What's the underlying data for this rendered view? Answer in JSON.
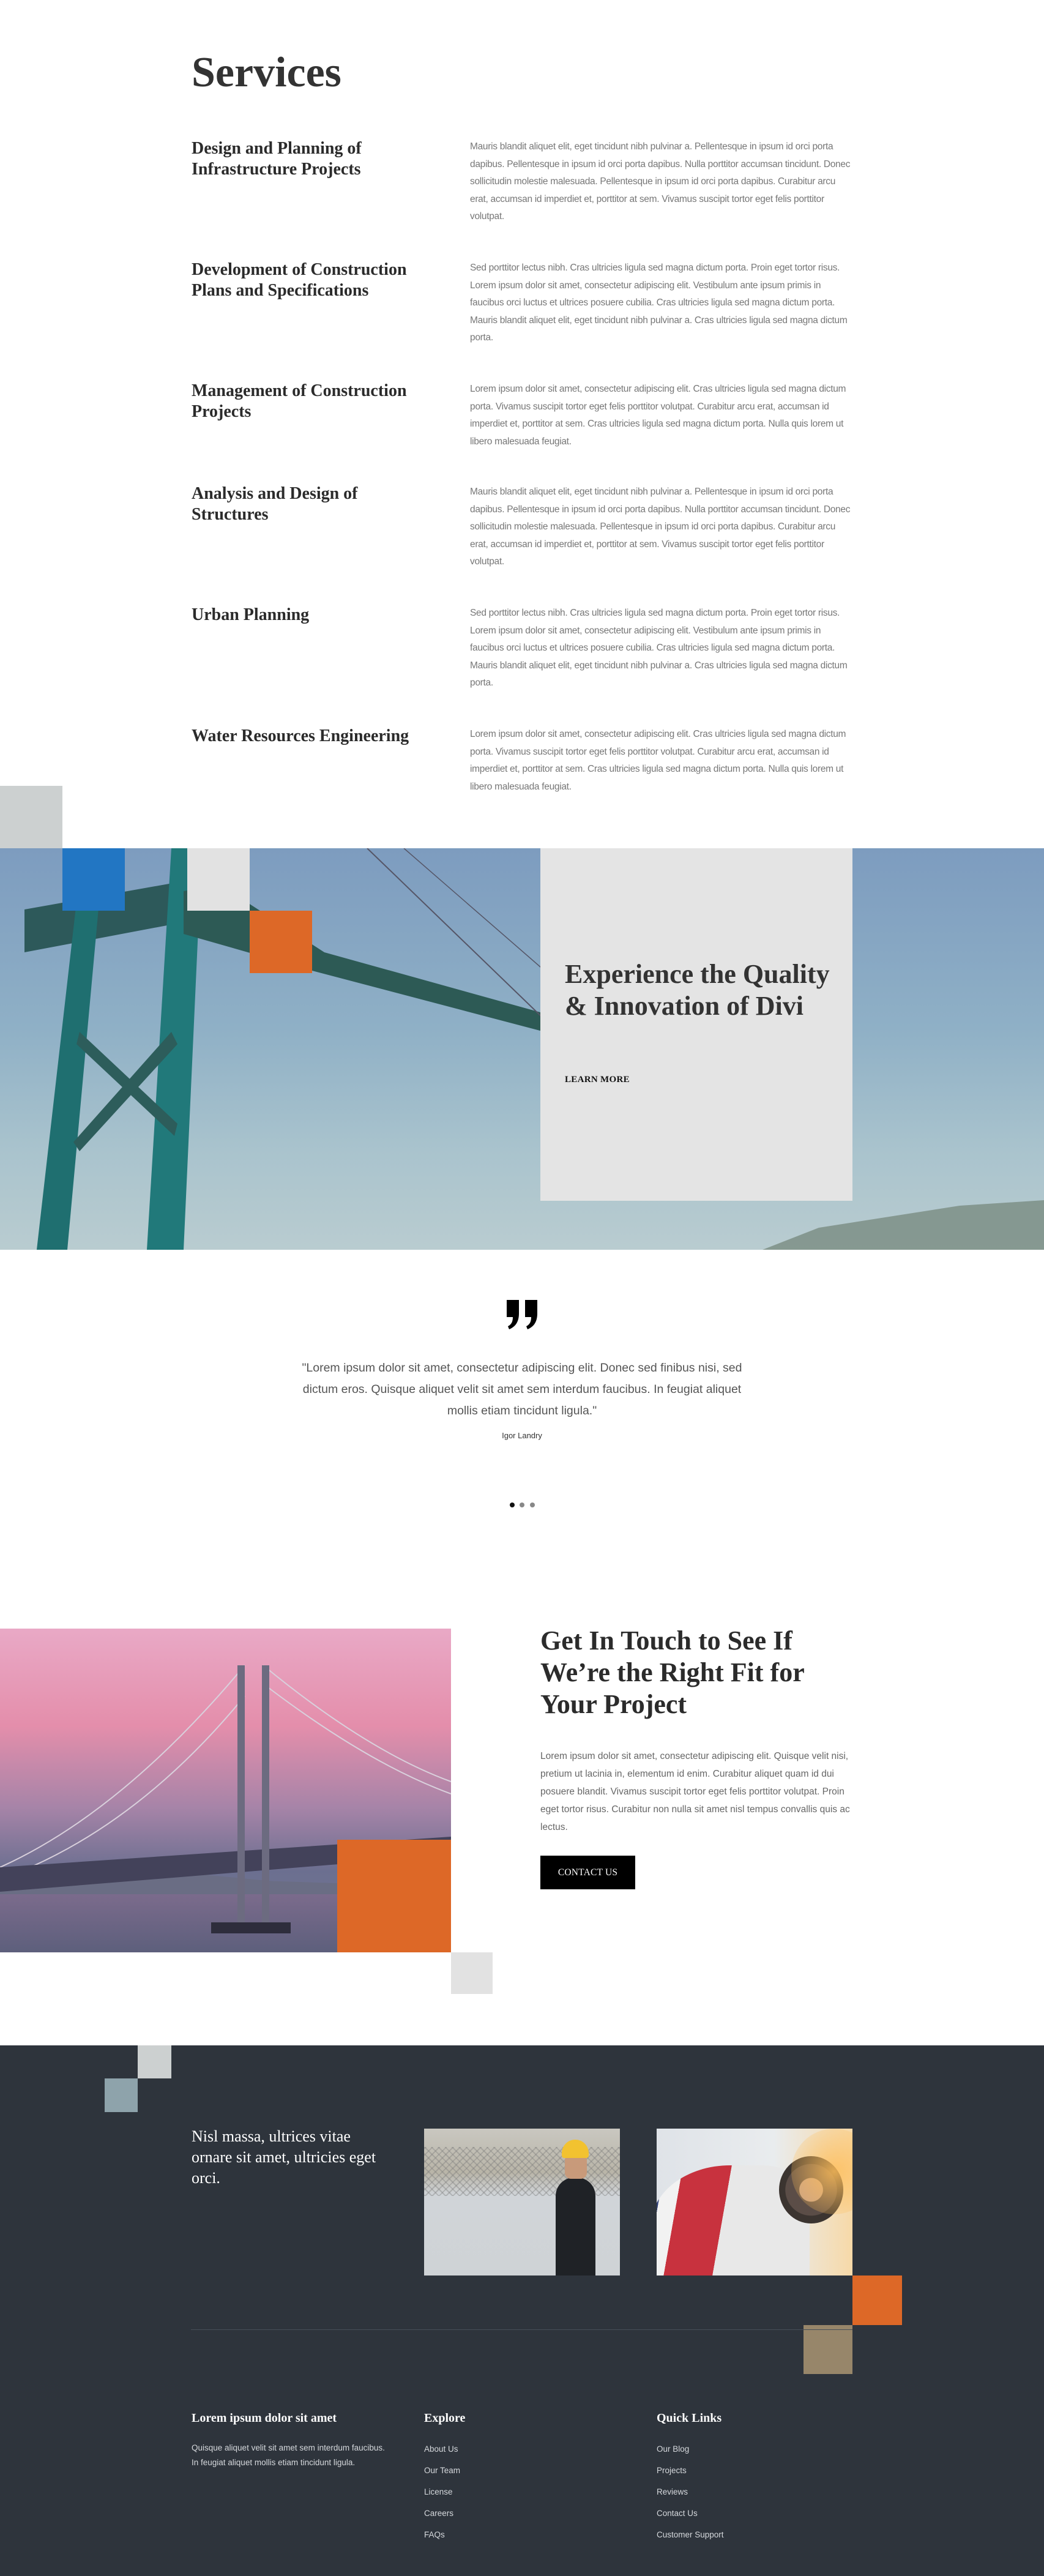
{
  "colors": {
    "accent_orange": "#dd6827",
    "accent_blue": "#2276c3",
    "light_gray": "#e2e2e2",
    "mid_gray": "#ccd0d0",
    "slate_blue_gray": "#8ea3ab",
    "khaki": "#97866a",
    "footer_bg": "#2e343c",
    "card_bg": "#e4e4e4"
  },
  "services": {
    "title": "Services",
    "items": [
      {
        "heading": "Design and Planning of Infrastructure Projects",
        "body": "Mauris blandit aliquet elit, eget tincidunt nibh pulvinar a. Pellentesque in ipsum id orci porta dapibus. Pellentesque in ipsum id orci porta dapibus. Nulla porttitor accumsan tincidunt. Donec sollicitudin molestie malesuada. Pellentesque in ipsum id orci porta dapibus. Curabitur arcu erat, accumsan id imperdiet et, porttitor at sem. Vivamus suscipit tortor eget felis porttitor volutpat."
      },
      {
        "heading": "Development of Construction Plans and Specifications",
        "body": "Sed porttitor lectus nibh. Cras ultricies ligula sed magna dictum porta. Proin eget tortor risus. Lorem ipsum dolor sit amet, consectetur adipiscing elit. Vestibulum ante ipsum primis in faucibus orci luctus et ultrices posuere cubilia. Cras ultricies ligula sed magna dictum porta. Mauris blandit aliquet elit, eget tincidunt nibh pulvinar a. Cras ultricies ligula sed magna dictum porta."
      },
      {
        "heading": "Management of Construction Projects",
        "body": "Lorem ipsum dolor sit amet, consectetur adipiscing elit. Cras ultricies ligula sed magna dictum porta. Vivamus suscipit tortor eget felis porttitor volutpat. Curabitur arcu erat, accumsan id imperdiet et, porttitor at sem. Cras ultricies ligula sed magna dictum porta. Nulla quis lorem ut libero malesuada feugiat."
      },
      {
        "heading": "Analysis and Design of Structures",
        "body": "Mauris blandit aliquet elit, eget tincidunt nibh pulvinar a. Pellentesque in ipsum id orci porta dapibus. Pellentesque in ipsum id orci porta dapibus. Nulla porttitor accumsan tincidunt. Donec sollicitudin molestie malesuada. Pellentesque in ipsum id orci porta dapibus. Curabitur arcu erat, accumsan id imperdiet et, porttitor at sem. Vivamus suscipit tortor eget felis porttitor volutpat."
      },
      {
        "heading": "Urban Planning",
        "body": "Sed porttitor lectus nibh. Cras ultricies ligula sed magna dictum porta. Proin eget tortor risus. Lorem ipsum dolor sit amet, consectetur adipiscing elit. Vestibulum ante ipsum primis in faucibus orci luctus et ultrices posuere cubilia. Cras ultricies ligula sed magna dictum porta. Mauris blandit aliquet elit, eget tincidunt nibh pulvinar a. Cras ultricies ligula sed magna dictum porta."
      },
      {
        "heading": "Water Resources Engineering",
        "body": "Lorem ipsum dolor sit amet, consectetur adipiscing elit. Cras ultricies ligula sed magna dictum porta. Vivamus suscipit tortor eget felis porttitor volutpat. Curabitur arcu erat, accumsan id imperdiet et, porttitor at sem. Cras ultricies ligula sed magna dictum porta. Nulla quis lorem ut libero malesuada feugiat."
      }
    ]
  },
  "banner": {
    "title": "Experience the Quality & Innovation of Divi",
    "cta_label": "LEARN MORE",
    "image": "steel-bridge-photo"
  },
  "testimonial": {
    "icon": "quote-icon",
    "quote": "\"Lorem ipsum dolor sit amet, consectetur adipiscing elit. Donec sed finibus nisi, sed dictum eros. Quisque aliquet velit sit amet sem interdum faucibus. In feugiat aliquet mollis etiam tincidunt ligula.\"",
    "author": "Igor Landry",
    "slide_count": 3,
    "active_slide": 1
  },
  "contact": {
    "title": "Get In Touch to See If We’re the Right Fit for Your Project",
    "body": "Lorem ipsum dolor sit amet, consectetur adipiscing elit. Quisque velit nisi, pretium ut lacinia in, elementum id enim. Curabitur aliquet quam id dui posuere blandit. Vivamus suscipit tortor eget felis porttitor volutpat. Proin eget tortor risus. Curabitur non nulla sit amet nisl tempus convallis quis ac lectus.",
    "button_label": "CONTACT US",
    "image": "suspension-bridge-sunset-photo"
  },
  "footer": {
    "tagline": "Nisl massa, ultrices vitae ornare sit amet, ultricies eget orci.",
    "images": [
      "engineer-with-tablet-photo",
      "concrete-mixer-truck-photo"
    ],
    "about": {
      "title": "Lorem ipsum dolor sit amet",
      "text": "Quisque aliquet velit sit amet sem interdum faucibus. In feugiat aliquet mollis etiam tincidunt ligula."
    },
    "explore": {
      "title": "Explore",
      "links": [
        "About Us",
        "Our Team",
        "License",
        "Careers",
        "FAQs"
      ]
    },
    "quick_links": {
      "title": "Quick Links",
      "links": [
        "Our Blog",
        "Projects",
        "Reviews",
        "Contact Us",
        "Customer Support"
      ]
    }
  }
}
